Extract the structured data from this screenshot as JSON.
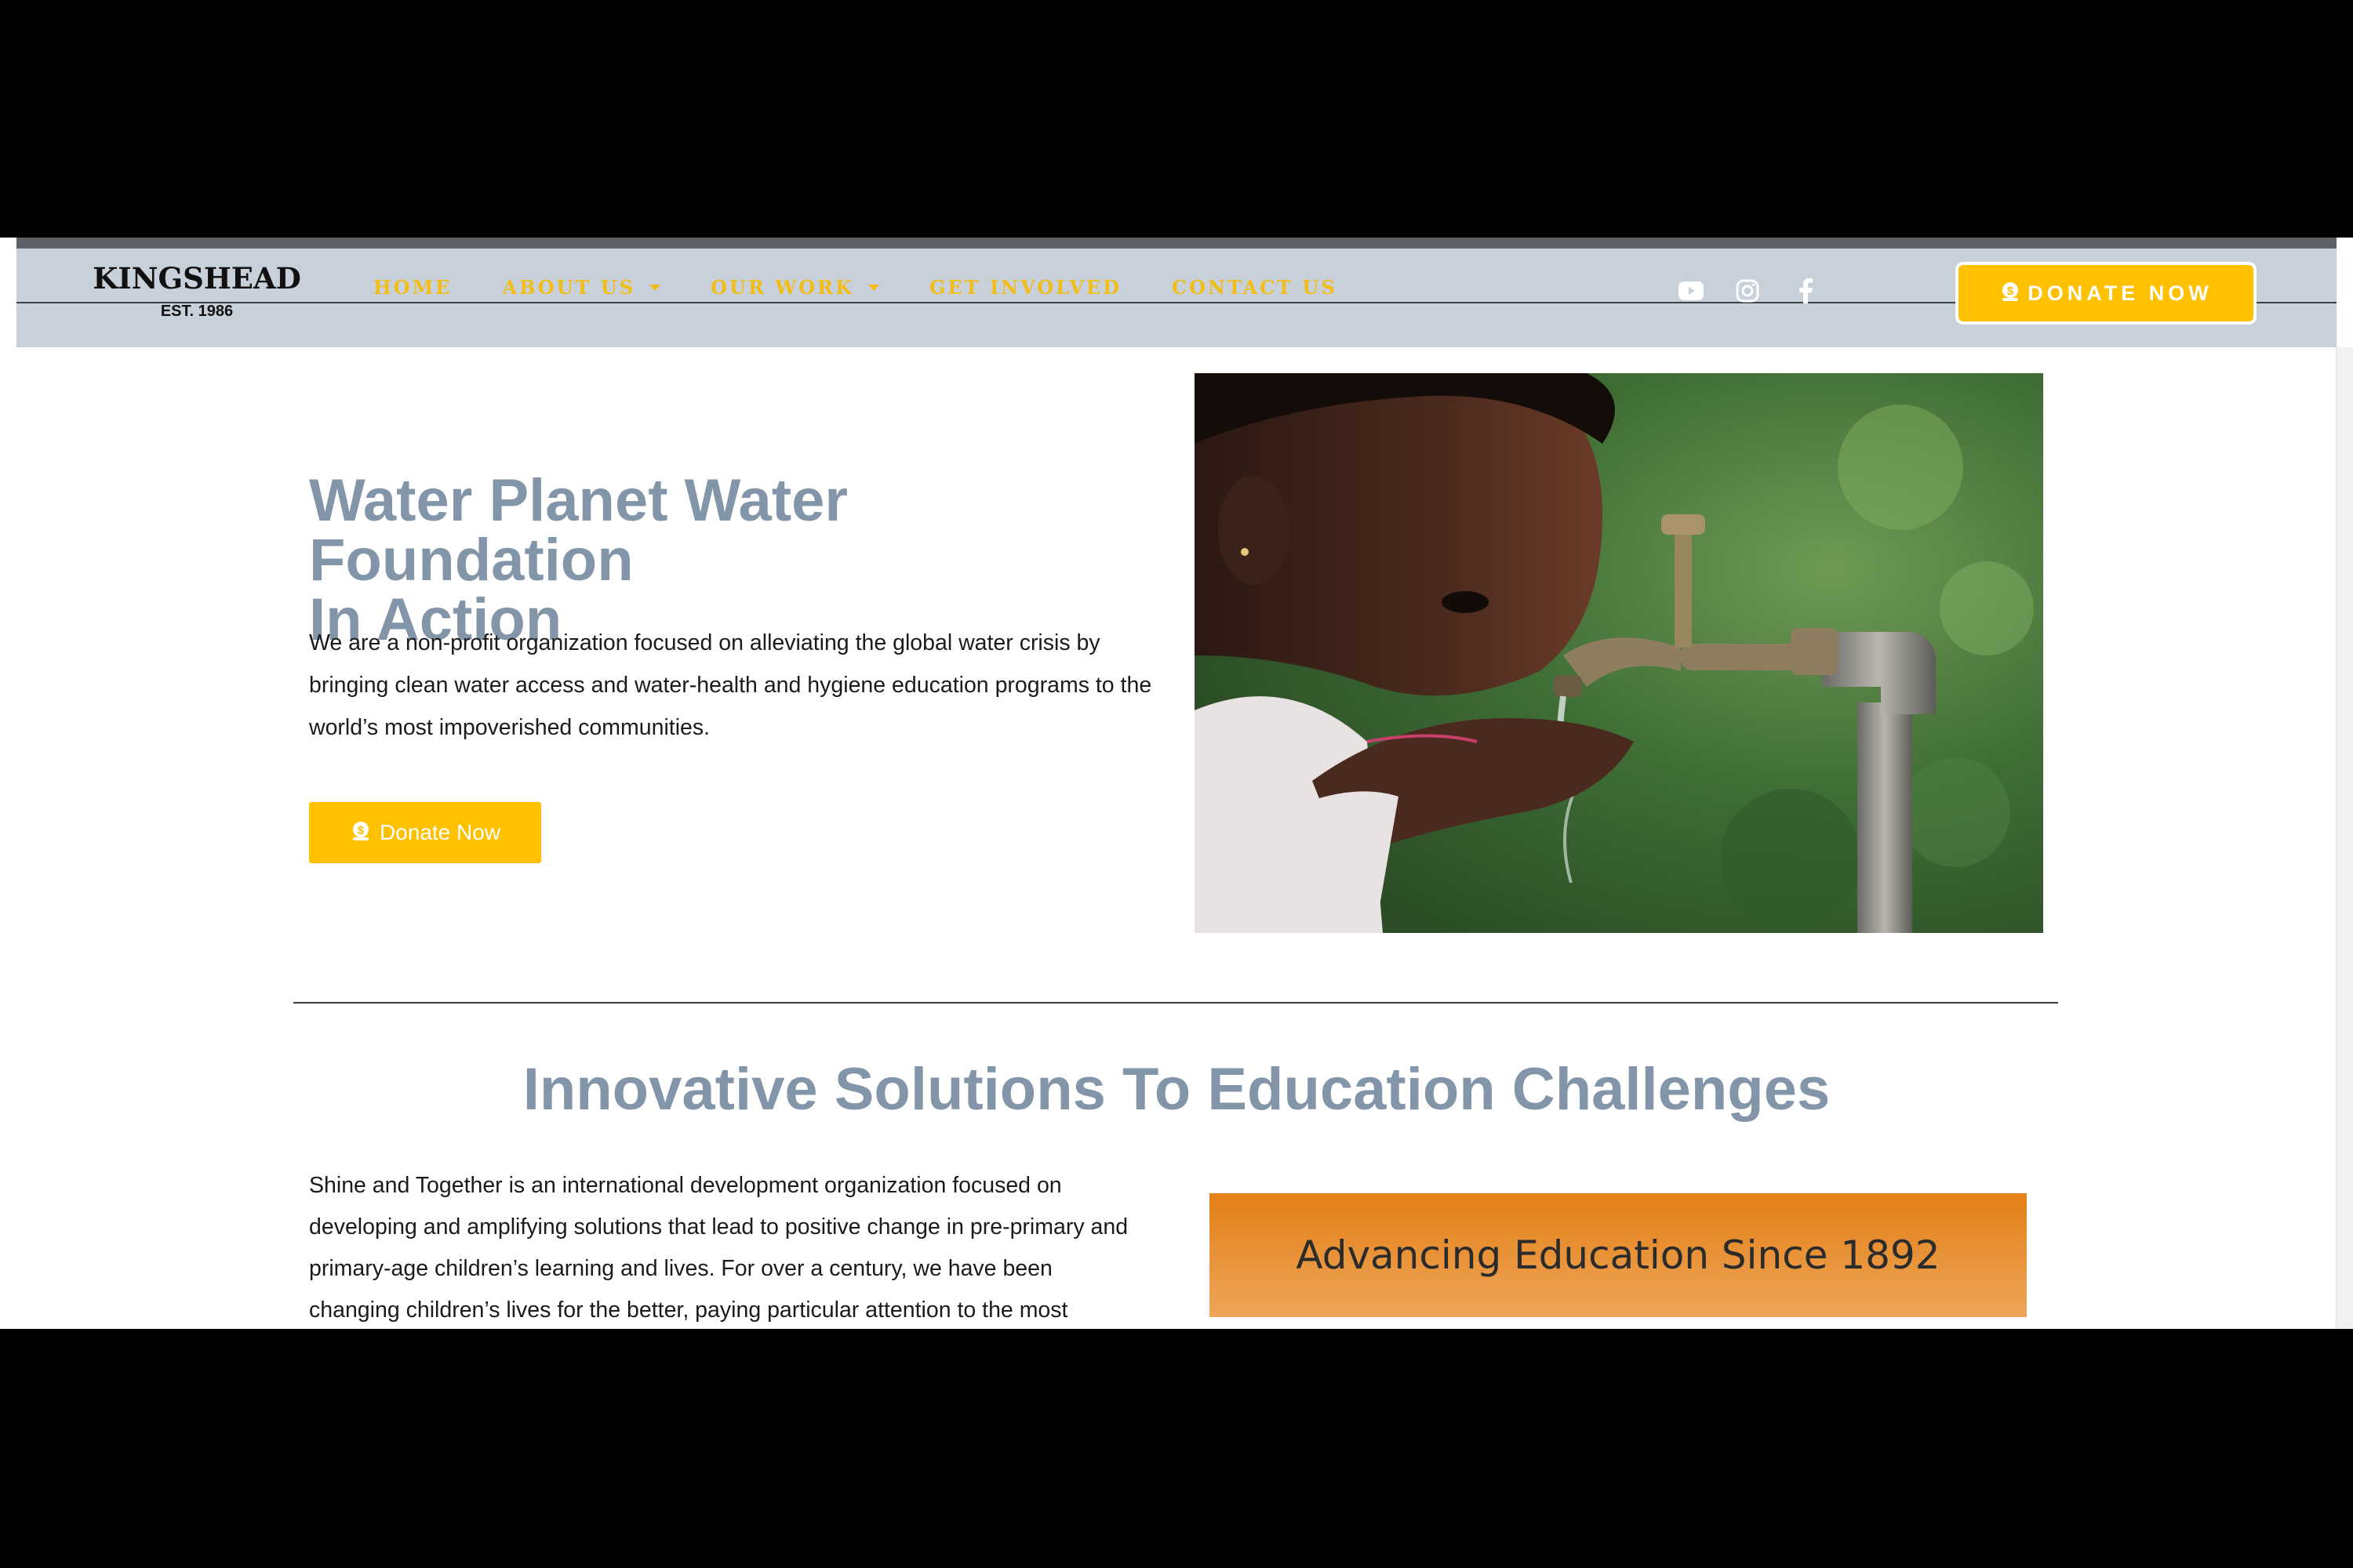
{
  "brand": {
    "name": "KINGSHEAD",
    "established": "EST. 1986"
  },
  "nav": {
    "items": [
      {
        "label": "HOME",
        "has_dropdown": false
      },
      {
        "label": "ABOUT US",
        "has_dropdown": true
      },
      {
        "label": "OUR WORK",
        "has_dropdown": true
      },
      {
        "label": "GET INVOLVED",
        "has_dropdown": false
      },
      {
        "label": "CONTACT US",
        "has_dropdown": false
      }
    ]
  },
  "social": {
    "icons": [
      "youtube-icon",
      "instagram-icon",
      "facebook-icon"
    ]
  },
  "header_cta": {
    "label": "DONATE NOW",
    "icon": "donate-coin-icon"
  },
  "hero": {
    "title_line1": "Water Planet Water Foundation",
    "title_line2": "In Action",
    "body": "We are a non-profit organization focused on alleviating the global water crisis by bringing clean water access and water-health and hygiene education programs to the world’s most impoverished communities.",
    "button_label": "Donate Now",
    "button_icon": "donate-coin-icon"
  },
  "section": {
    "title": "Innovative Solutions To Education Challenges",
    "body": "Shine and Together is an international development organization focused on developing and amplifying solutions that lead to positive change in pre-primary and primary-age children’s learning and lives. For over a century, we have been changing children’s lives for the better, paying particular attention to the most",
    "banner_text": "Advancing Education Since 1892"
  },
  "colors": {
    "accent": "#ffc000",
    "nav_text": "#f3bd17",
    "heading": "#8395a8",
    "header_bg": "#c8d0d9",
    "banner_top": "#e37f16",
    "banner_bottom": "#eea65a"
  }
}
